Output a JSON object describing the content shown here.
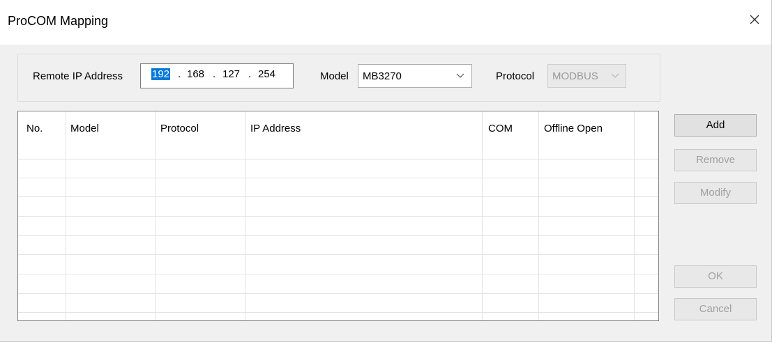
{
  "window": {
    "title": "ProCOM Mapping"
  },
  "form": {
    "remote_ip_label": "Remote IP Address",
    "ip": [
      "192",
      "168",
      "127",
      "254"
    ],
    "model_label": "Model",
    "model_value": "MB3270",
    "protocol_label": "Protocol",
    "protocol_value": "MODBUS"
  },
  "table": {
    "columns": [
      "No.",
      "Model",
      "Protocol",
      "IP Address",
      "COM",
      "Offline Open"
    ],
    "rows": []
  },
  "buttons": {
    "add": "Add",
    "remove": "Remove",
    "modify": "Modify",
    "ok": "OK",
    "cancel": "Cancel"
  }
}
